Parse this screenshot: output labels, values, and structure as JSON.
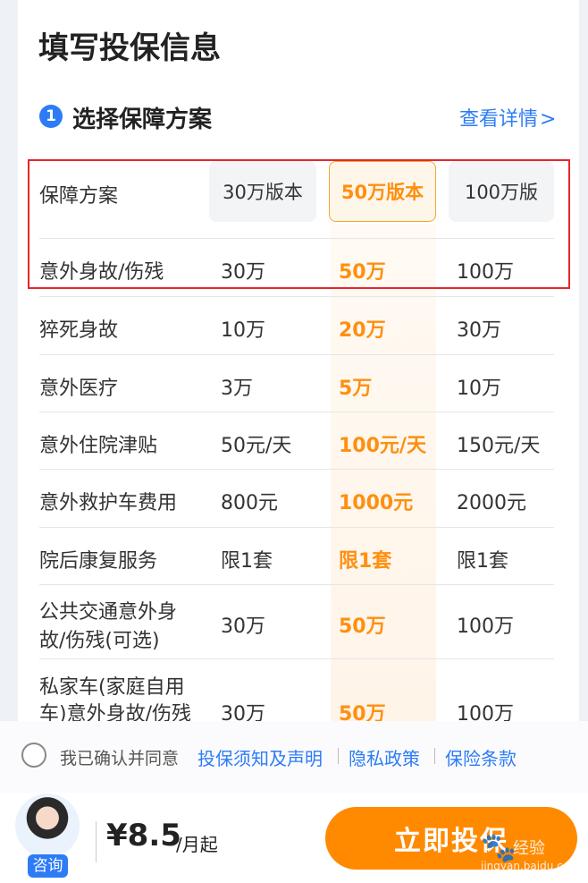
{
  "page": {
    "title": "填写投保信息"
  },
  "section": {
    "step": "1",
    "title": "选择保障方案",
    "detail_link": "查看详情",
    "chevron": ">"
  },
  "plans": {
    "header_label": "保障方案",
    "options": [
      "30万版本",
      "50万版本",
      "100万版"
    ],
    "selected_index": 1
  },
  "rows": [
    {
      "label": "意外身故/伤残",
      "v1": "30万",
      "v2": "50万",
      "v3": "100万"
    },
    {
      "label": "猝死身故",
      "v1": "10万",
      "v2": "20万",
      "v3": "30万"
    },
    {
      "label": "意外医疗",
      "v1": "3万",
      "v2": "5万",
      "v3": "10万"
    },
    {
      "label": "意外住院津贴",
      "v1": "50元/天",
      "v2": "100元/天",
      "v3": "150元/天"
    },
    {
      "label": "意外救护车费用",
      "v1": "800元",
      "v2": "1000元",
      "v3": "2000元"
    },
    {
      "label": "院后康复服务",
      "v1": "限1套",
      "v2": "限1套",
      "v3": "限1套"
    },
    {
      "label_line1": "公共交通意外身",
      "label_line2": "故/伤残(可选)",
      "v1": "30万",
      "v2": "50万",
      "v3": "100万"
    },
    {
      "label_line1": "私家车(家庭自用",
      "label_line2": "车)意外身故/伤残",
      "v1": "30万",
      "v2": "50万",
      "v3": "100万"
    }
  ],
  "agreement": {
    "text": "我已确认并同意",
    "links": [
      "投保须知及声明",
      "隐私政策",
      "保险条款"
    ],
    "checked": false
  },
  "footer": {
    "consult": "咨询",
    "price": "¥8.5",
    "price_unit": "/月起",
    "buy_button": "立即投保"
  },
  "watermark": {
    "brand": "经验",
    "url": "jingyan.baidu.com"
  },
  "colors": {
    "accent": "#2d7cf6",
    "orange": "#ff8f0f",
    "highlight": "#e5262e"
  }
}
